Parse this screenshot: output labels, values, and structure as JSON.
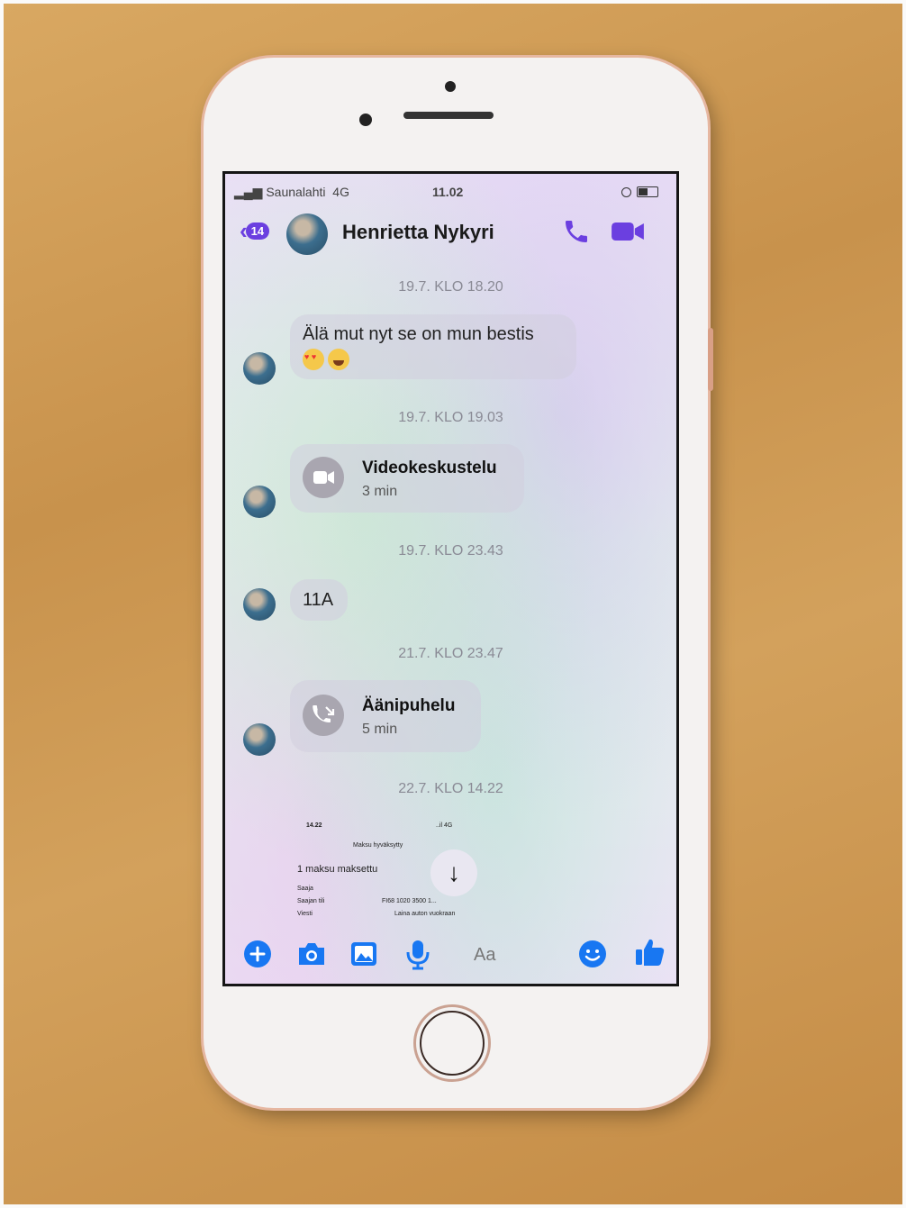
{
  "status_bar": {
    "carrier": "Saunalahti",
    "network": "4G",
    "time": "11.02"
  },
  "header": {
    "back_badge": "14",
    "contact_name": "Henrietta Nykyri"
  },
  "messages": {
    "ts1": "19.7. KLO 18.20",
    "msg1": "Älä mut nyt se on mun bestis",
    "ts2": "19.7. KLO 19.03",
    "video_call": {
      "title": "Videokeskustelu",
      "duration": "3 min"
    },
    "ts3": "19.7. KLO 23.43",
    "msg2": "11A",
    "ts4": "21.7. KLO 23.47",
    "voice_call": {
      "title": "Äänipuhelu",
      "duration": "5 min"
    },
    "ts5": "22.7. KLO 14.22"
  },
  "receipt": {
    "time": "14.22",
    "status": "..il 4G",
    "title": "Maksu hyväksytty",
    "summary": "1 maksu maksettu",
    "row1_label": "Saaja",
    "row2_label": "Saajan tili",
    "row2_value": "FI68 1020 3500 1...",
    "row3_label": "Viesti",
    "row3_value": "Laina auton vuokraan"
  },
  "composer": {
    "placeholder": "Aa"
  },
  "colors": {
    "accent": "#1877f2",
    "header_accent": "#6b3fe0"
  },
  "icons": [
    "plus-icon",
    "camera-icon",
    "image-icon",
    "microphone-icon",
    "emoji-icon",
    "thumbs-up-icon",
    "phone-icon",
    "video-camera-icon",
    "arrow-down-icon"
  ]
}
